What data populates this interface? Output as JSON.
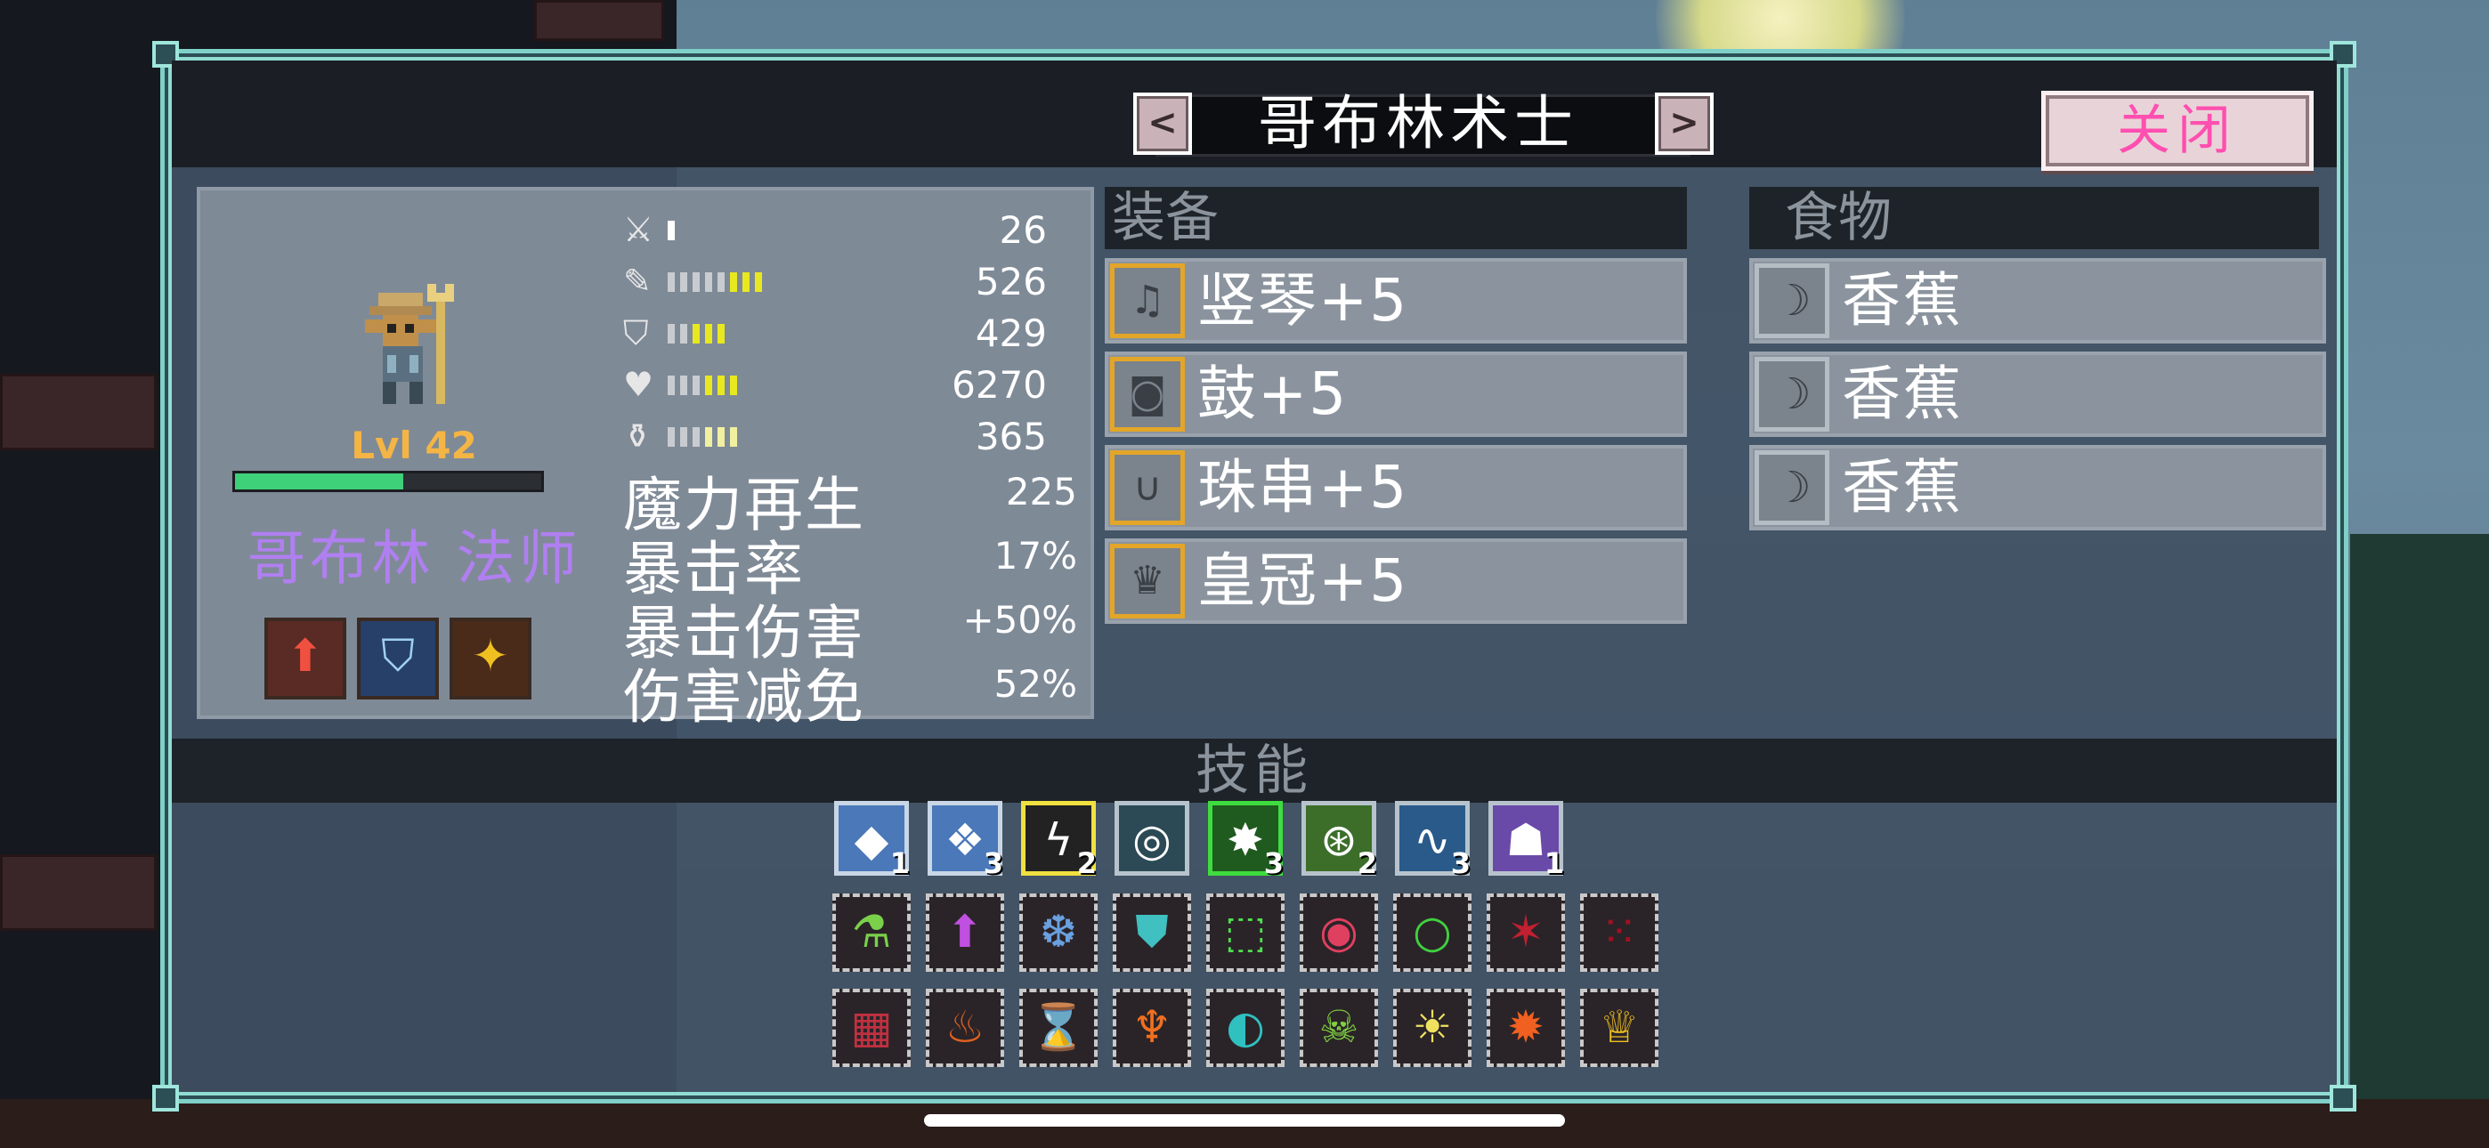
{
  "header": {
    "prev_glyph": "<",
    "next_glyph": ">",
    "title": "哥布林术士",
    "close_label": "关闭"
  },
  "hero": {
    "level": "Lvl 42",
    "xp_progress": 0.55,
    "name": "哥布林 法师",
    "perks": [
      "attack-up-perk-icon",
      "defense-shield-perk-icon",
      "star-burst-perk-icon"
    ]
  },
  "stats": {
    "bars": [
      {
        "icon": "sword-attack-icon",
        "value": "26",
        "filled": 1,
        "color": "#ffffff"
      },
      {
        "icon": "staff-magic-icon",
        "value": "526",
        "filled": 8,
        "color": "#e8e820"
      },
      {
        "icon": "shield-defense-icon",
        "value": "429",
        "filled": 5,
        "color": "#e8e820"
      },
      {
        "icon": "heart-health-icon",
        "value": "6270",
        "filled": 6,
        "color": "#e8e820"
      },
      {
        "icon": "mana-flask-icon",
        "value": "365",
        "filled": 6,
        "color": "#f0f0a0"
      }
    ],
    "text": [
      {
        "label": "魔力再生",
        "value": "225"
      },
      {
        "label": "暴击率",
        "value": "17%"
      },
      {
        "label": "暴击伤害",
        "value": "+50%"
      },
      {
        "label": "伤害减免",
        "value": "52%"
      }
    ]
  },
  "equipment": {
    "header": "装备",
    "items": [
      {
        "icon": "harp-icon",
        "label": "竖琴+5"
      },
      {
        "icon": "drum-icon",
        "label": "鼓+5"
      },
      {
        "icon": "bead-necklace-icon",
        "label": "珠串+5"
      },
      {
        "icon": "crown-icon",
        "label": "皇冠+5"
      }
    ]
  },
  "food": {
    "header": "食物",
    "items": [
      {
        "icon": "banana-icon",
        "label": "香蕉"
      },
      {
        "icon": "banana-icon",
        "label": "香蕉"
      },
      {
        "icon": "banana-icon",
        "label": "香蕉"
      }
    ]
  },
  "skills": {
    "header": "技能",
    "active": [
      {
        "icon": "ice-shard-skill-icon",
        "count": "1",
        "bg": "#4a78b8",
        "border": "#c9d6e6",
        "glyph": "◆"
      },
      {
        "icon": "ice-crystal-skill-icon",
        "count": "3",
        "bg": "#4a78b8",
        "border": "#c9d6e6",
        "glyph": "❖"
      },
      {
        "icon": "lightning-skill-icon",
        "count": "2",
        "bg": "#222222",
        "border": "#f0e040",
        "glyph": "ϟ"
      },
      {
        "icon": "arcane-ring-skill-icon",
        "count": "",
        "bg": "#2b4a56",
        "border": "#b7c3cc",
        "glyph": "◎"
      },
      {
        "icon": "poison-cloud-skill-icon",
        "count": "3",
        "bg": "#1f5a1f",
        "border": "#3fdc3f",
        "glyph": "✸"
      },
      {
        "icon": "toxic-orb-skill-icon",
        "count": "2",
        "bg": "#3c6e2a",
        "border": "#b7c3cc",
        "glyph": "⊛"
      },
      {
        "icon": "water-wave-skill-icon",
        "count": "3",
        "bg": "#2a5a8a",
        "border": "#b7c3cc",
        "glyph": "∿"
      },
      {
        "icon": "shadow-beast-skill-icon",
        "count": "1",
        "bg": "#6a4aa8",
        "border": "#b7c3cc",
        "glyph": "☗"
      }
    ],
    "passive_row1": [
      {
        "icon": "poison-flask-passive-icon",
        "color": "#7ad04a",
        "glyph": "⚗"
      },
      {
        "icon": "mana-potion-up-passive-icon",
        "color": "#c050e0",
        "glyph": "⬆"
      },
      {
        "icon": "ice-armor-passive-icon",
        "color": "#6aa0e0",
        "glyph": "❆"
      },
      {
        "icon": "mana-shield-passive-icon",
        "color": "#40c0c0",
        "glyph": "⛊"
      },
      {
        "icon": "green-target-passive-icon",
        "color": "#50e050",
        "glyph": "⬚"
      },
      {
        "icon": "eye-orb-passive-icon",
        "color": "#e04060",
        "glyph": "◉"
      },
      {
        "icon": "green-ring-passive-icon",
        "color": "#40d040",
        "glyph": "○"
      },
      {
        "icon": "blood-burst-passive-icon",
        "color": "#c02030",
        "glyph": "✶"
      },
      {
        "icon": "red-dots-passive-icon",
        "color": "#a01020",
        "glyph": "⁙"
      }
    ],
    "passive_row2": [
      {
        "icon": "red-gems-passive-icon",
        "color": "#c03040",
        "glyph": "▦"
      },
      {
        "icon": "fire-candles-passive-icon",
        "color": "#e06020",
        "glyph": "♨"
      },
      {
        "icon": "hourglass-passive-icon",
        "color": "#f08020",
        "glyph": "⌛"
      },
      {
        "icon": "fire-bat-passive-icon",
        "color": "#f07020",
        "glyph": "♆"
      },
      {
        "icon": "cyan-vortex-passive-icon",
        "color": "#30c0c0",
        "glyph": "◐"
      },
      {
        "icon": "green-demon-passive-icon",
        "color": "#80d040",
        "glyph": "☠"
      },
      {
        "icon": "lightbulb-passive-icon",
        "color": "#f0e060",
        "glyph": "☀"
      },
      {
        "icon": "fire-orb-passive-icon",
        "color": "#f06020",
        "glyph": "✹"
      },
      {
        "icon": "crowned-ring-passive-icon",
        "color": "#f0c020",
        "glyph": "♕"
      }
    ]
  }
}
